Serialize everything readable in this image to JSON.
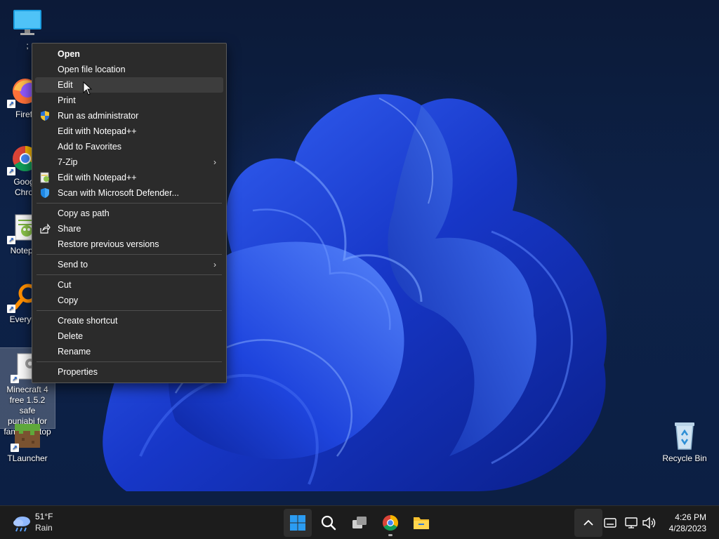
{
  "desktop": {
    "icons": [
      {
        "label": ";",
        "icon": "monitor-icon"
      },
      {
        "label": "Firef",
        "icon": "firefox-icon"
      },
      {
        "label": "Goog\nChro",
        "icon": "chrome-icon"
      },
      {
        "label": "Notepa",
        "icon": "notepad-plus-plus-icon"
      },
      {
        "label": "Everyth",
        "icon": "everything-search-icon"
      },
      {
        "label": "Minecraft 4\nfree 1.5.2 safe\npunjabi for\nfamily laptop",
        "icon": "settings-file-icon"
      },
      {
        "label": "TLauncher",
        "icon": "minecraft-grass-block-icon"
      },
      {
        "label": "Recycle Bin",
        "icon": "recycle-bin-icon"
      }
    ]
  },
  "context_menu": {
    "items": [
      {
        "label": "Open",
        "bold": true
      },
      {
        "label": "Open file location"
      },
      {
        "label": "Edit",
        "hover": true
      },
      {
        "label": "Print"
      },
      {
        "label": "Run as administrator",
        "icon": "uac-shield-icon"
      },
      {
        "label": "Edit with Notepad++"
      },
      {
        "label": "Add to Favorites"
      },
      {
        "label": "7-Zip",
        "submenu": true
      },
      {
        "label": "Edit with Notepad++",
        "icon": "notepad-plus-plus-icon"
      },
      {
        "label": "Scan with Microsoft Defender...",
        "icon": "defender-shield-icon"
      },
      {
        "separator": true
      },
      {
        "label": "Copy as path"
      },
      {
        "label": "Share",
        "icon": "share-icon"
      },
      {
        "label": "Restore previous versions"
      },
      {
        "separator": true
      },
      {
        "label": "Send to",
        "submenu": true
      },
      {
        "separator": true
      },
      {
        "label": "Cut"
      },
      {
        "label": "Copy"
      },
      {
        "separator": true
      },
      {
        "label": "Create shortcut"
      },
      {
        "label": "Delete"
      },
      {
        "label": "Rename"
      },
      {
        "separator": true
      },
      {
        "label": "Properties"
      }
    ],
    "submenu_glyph": "›"
  },
  "taskbar": {
    "weather": {
      "temp": "51°F",
      "desc": "Rain",
      "icon": "rain-cloud-icon"
    },
    "apps": [
      {
        "name": "start",
        "icon": "windows-start-icon",
        "active": true
      },
      {
        "name": "search",
        "icon": "search-icon"
      },
      {
        "name": "task-view",
        "icon": "task-view-icon"
      },
      {
        "name": "chrome",
        "icon": "chrome-icon",
        "running": true
      },
      {
        "name": "file-explorer",
        "icon": "folder-icon"
      }
    ],
    "tray": {
      "overflow_icon": "chevron-up-icon",
      "icons": [
        "touch-keyboard-icon",
        "network-icon",
        "volume-icon"
      ]
    },
    "clock": {
      "time": "4:26 PM",
      "date": "4/28/2023"
    }
  },
  "colors": {
    "menu_bg": "#2b2b2b",
    "menu_hover": "#3d3d3d",
    "taskbar_bg": "#1c1c1c",
    "accent": "#1a6fe0"
  }
}
